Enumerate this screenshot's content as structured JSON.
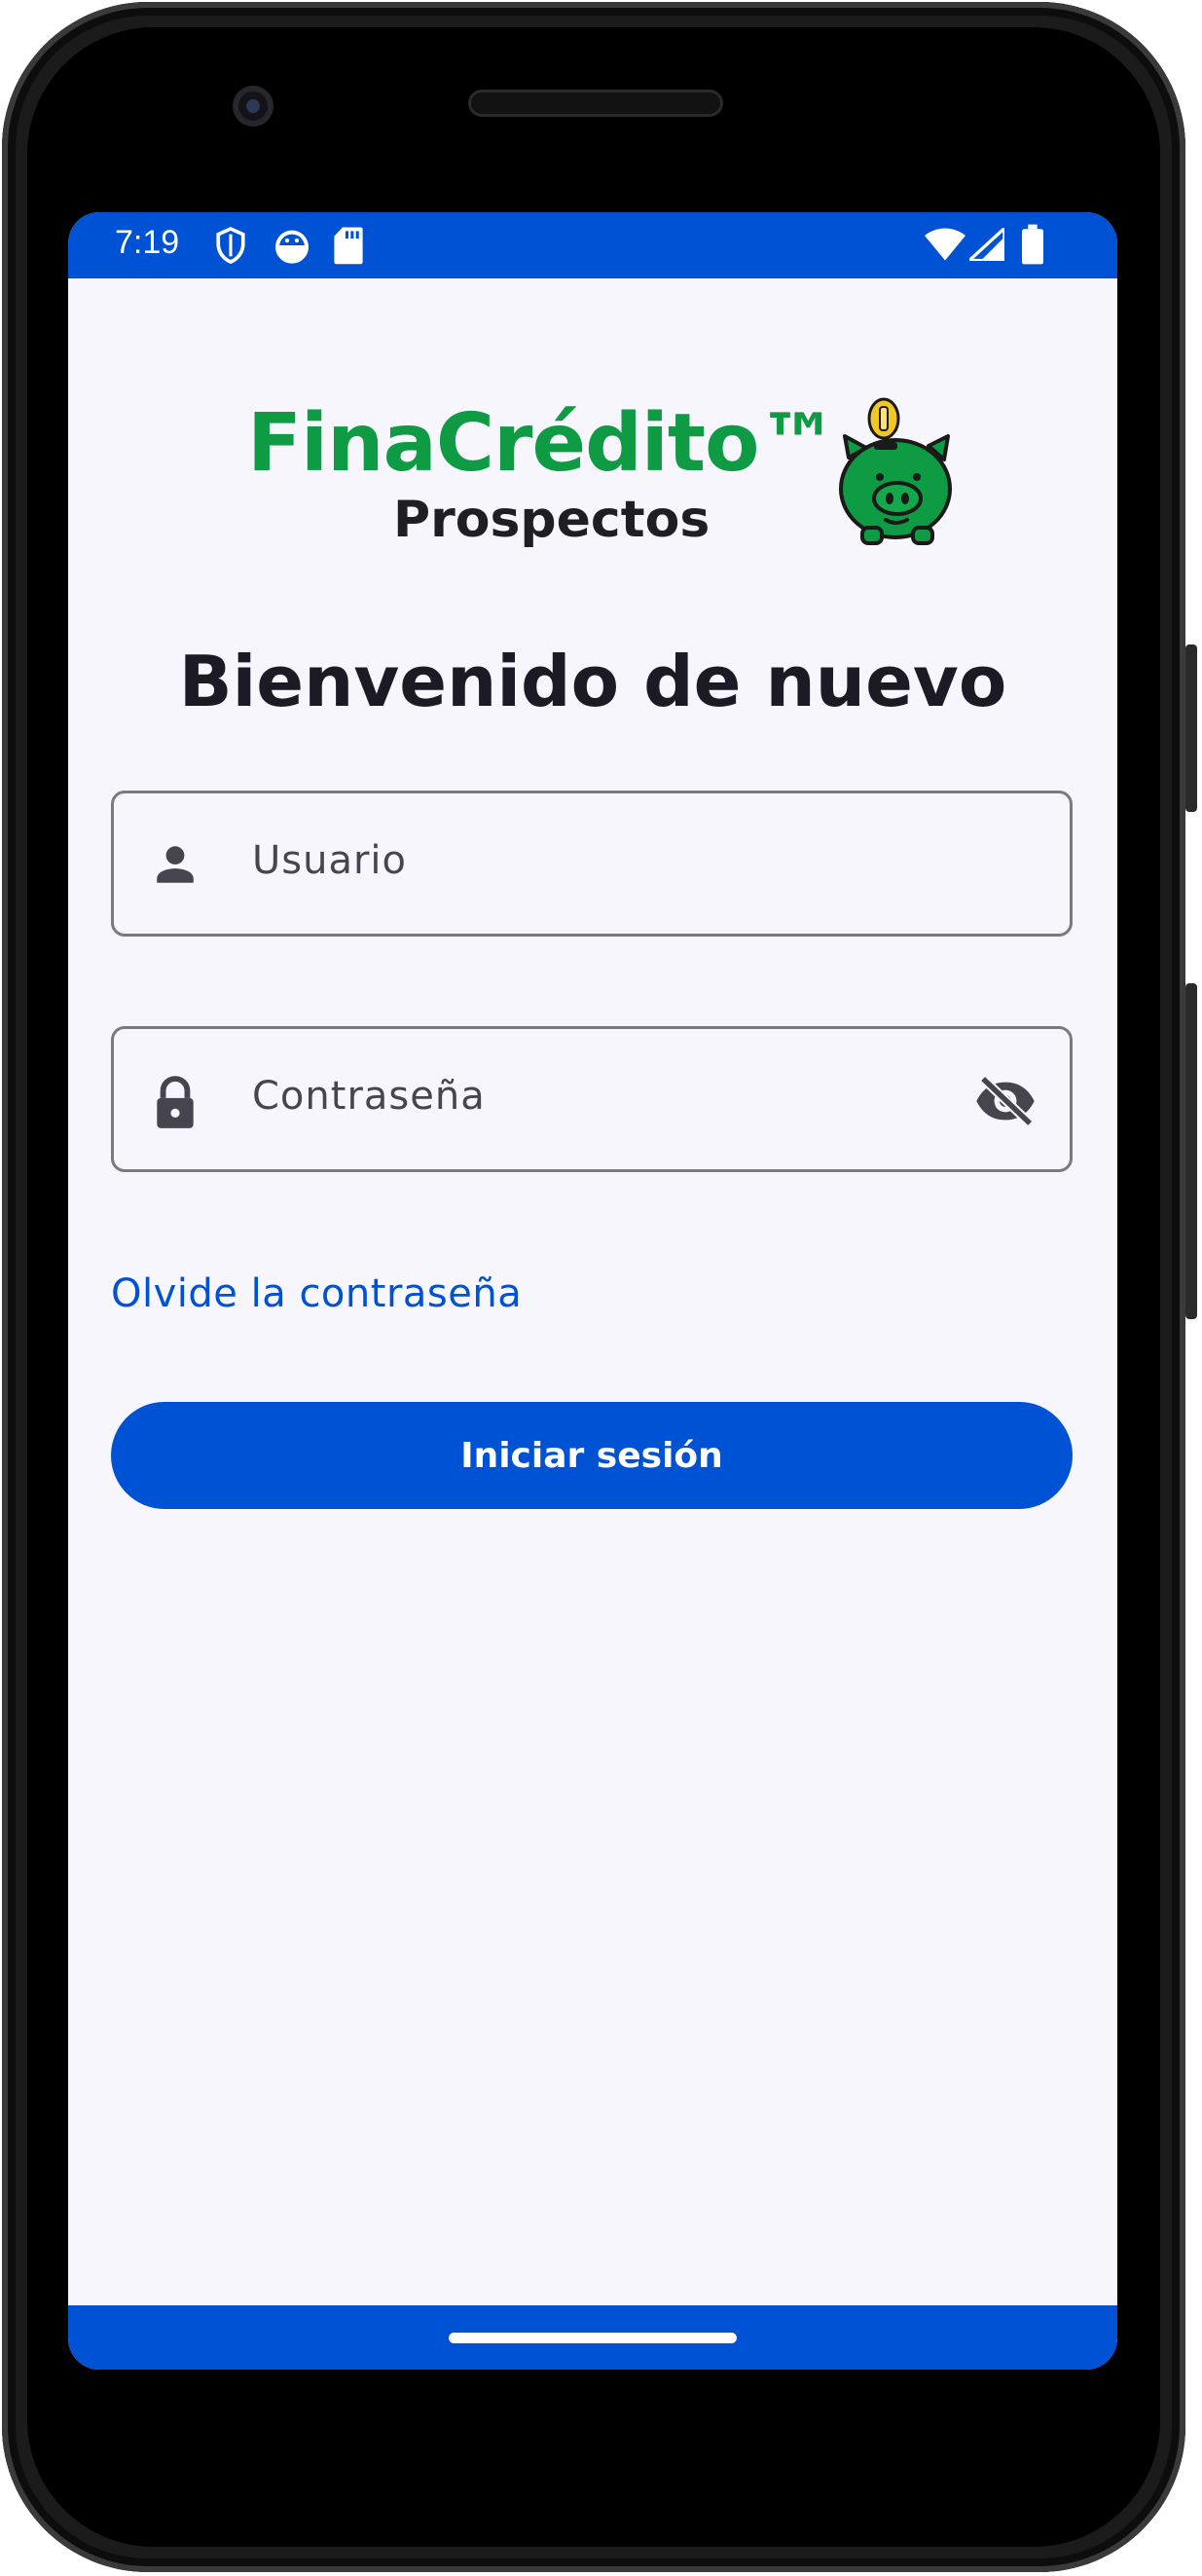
{
  "status_bar": {
    "time": "7:19",
    "icons": [
      "shield-icon",
      "android-debug-icon",
      "sd-card-icon",
      "wifi-icon",
      "signal-icon",
      "battery-icon"
    ]
  },
  "logo": {
    "brand": "FinaCrédito™",
    "subtitle": "Prospectos",
    "mascot": "piggy-bank-icon"
  },
  "login": {
    "title": "Bienvenido de nuevo",
    "username_placeholder": "Usuario",
    "password_placeholder": "Contraseña",
    "forgot_link": "Olvide la contraseña",
    "submit_label": "Iniciar sesión"
  },
  "colors": {
    "primary": "#0052d4",
    "brand_green": "#0f9a44",
    "background": "#f7f6fc",
    "text_dark": "#1c1b25"
  }
}
